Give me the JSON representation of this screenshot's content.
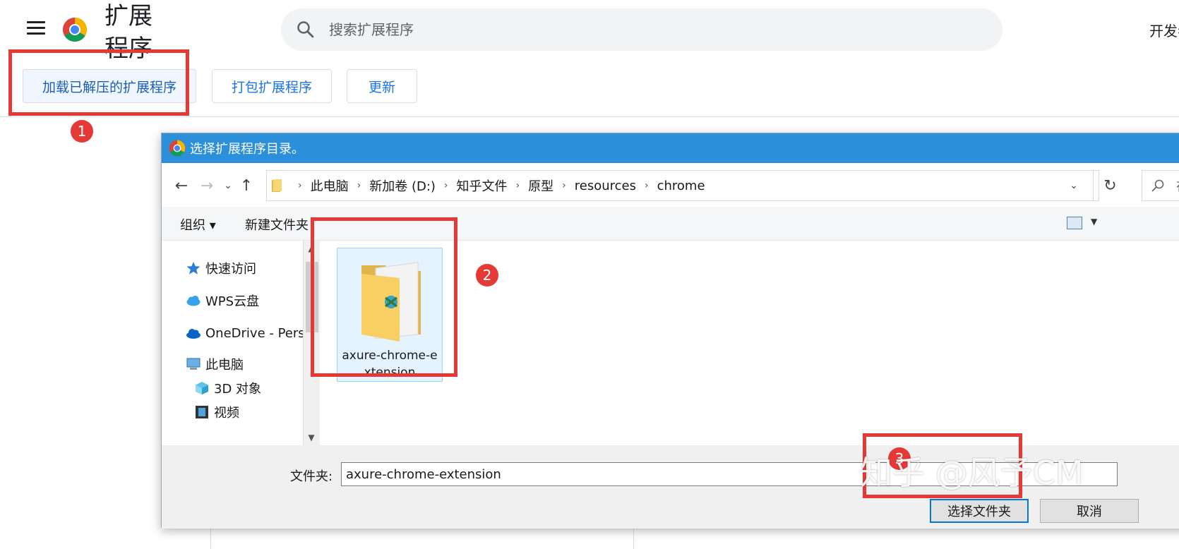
{
  "header": {
    "title": "扩展程序",
    "search_placeholder": "搜索扩展程序",
    "dev_mode_label": "开发者模式"
  },
  "toolbar": {
    "load_unpacked_label": "加载已解压的扩展程序",
    "pack_label": "打包扩展程序",
    "update_label": "更新"
  },
  "annotations": {
    "badge_1": "1",
    "badge_2": "2",
    "badge_3": "3"
  },
  "dialog": {
    "title": "选择扩展程序目录。",
    "breadcrumbs": [
      "此电脑",
      "新加卷 (D:)",
      "知乎文件",
      "原型",
      "resources",
      "chrome"
    ],
    "search_placeholder": "在 chrome 中搜索",
    "commands": {
      "organize_label": "组织 ▾",
      "new_folder_label": "新建文件夹"
    },
    "nav_items": [
      {
        "label": "快速访问",
        "icon": "star-icon"
      },
      {
        "label": "WPS云盘",
        "icon": "cloud-icon"
      },
      {
        "label": "OneDrive - Perso",
        "icon": "onedrive-icon"
      },
      {
        "label": "此电脑",
        "icon": "computer-icon"
      },
      {
        "label": "3D 对象",
        "icon": "cube-icon"
      },
      {
        "label": "视频",
        "icon": "video-icon"
      }
    ],
    "selected_folder": "axure-chrome-extension",
    "footer": {
      "folder_label": "文件夹:",
      "folder_value": "axure-chrome-extension",
      "select_button": "选择文件夹",
      "cancel_button": "取消"
    }
  },
  "watermark": "知乎 @风予CM",
  "colors": {
    "annotation_red": "#e53935",
    "dialog_titlebar": "#2b90d9",
    "accent_blue": "#1a73e8"
  }
}
